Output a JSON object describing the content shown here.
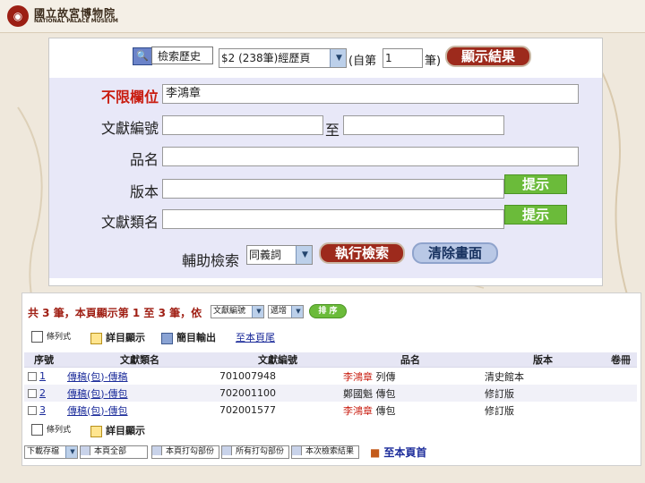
{
  "colors": {
    "accent_red": "#c91d10",
    "hint_green": "#6bbb3a",
    "form_bg": "#e8e8f8",
    "brand_red": "#9c1f14"
  },
  "header": {
    "org_name_cn": "國立故宮博物院",
    "org_name_en": "NATIONAL PALACE MUSEUM",
    "logo_icon": "seal-logo-icon"
  },
  "history": {
    "label": "檢索歷史",
    "selected": "$2 (238筆)經歷頁",
    "from_prefix": "(自第",
    "from_value": "1",
    "from_suffix": "筆)",
    "show_button": "顯示結果"
  },
  "form": {
    "any_field_label": "不限欄位",
    "any_field_value": "李鴻章",
    "doc_no_label": "文獻編號",
    "doc_no_to": "至",
    "title_label": "品名",
    "edition_label": "版本",
    "category_label": "文獻類名",
    "hint_button": "提示",
    "aux_label": "輔助檢索",
    "aux_selected": "同義詞",
    "search_button": "執行檢索",
    "clear_button": "清除畫面"
  },
  "results": {
    "summary": "共 3 筆，本頁顯示第 1 至 3 筆，依",
    "sort_field": "文獻編號",
    "sort_order": "遞增",
    "sort_button": "排 序",
    "toolbar": {
      "list_view": "條列式",
      "detail_view": "詳目顯示",
      "summary_export": "簡目輸出",
      "to_bottom": "至本頁尾"
    },
    "columns": [
      "序號",
      "文獻類名",
      "文獻編號",
      "品名",
      "版本",
      "卷冊"
    ],
    "rows": [
      {
        "no": "1",
        "category": "傳稿(包)-傳稿",
        "doc_no": "701007948",
        "name_hl": "李鴻章",
        "name_rest": " 列傳",
        "edition": "清史館本",
        "volume": ""
      },
      {
        "no": "2",
        "category": "傳稿(包)-傳包",
        "doc_no": "702001100",
        "name_hl": "",
        "name_rest": "鄭國魁 傳包",
        "edition": "修訂版",
        "volume": ""
      },
      {
        "no": "3",
        "category": "傳稿(包)-傳包",
        "doc_no": "702001577",
        "name_hl": "李鴻章",
        "name_rest": " 傳包",
        "edition": "修訂版",
        "volume": ""
      }
    ],
    "bottom": {
      "download_select": "下載存檔",
      "all_page": "本頁全部",
      "print_part": "本頁打勾部份",
      "print_all": "所有打勾部份",
      "this_search": "本次檢索結果",
      "to_top": "至本頁首"
    }
  }
}
